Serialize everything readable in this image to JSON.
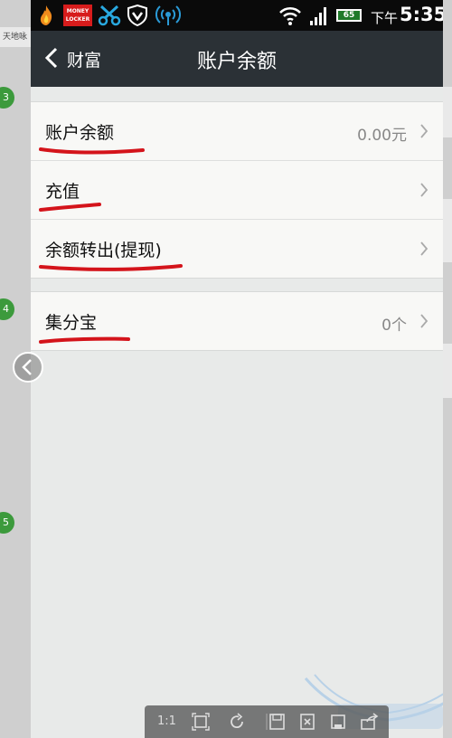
{
  "background_page": {
    "top_text": "天地咏",
    "step_numbers": [
      "3",
      "4",
      "5"
    ]
  },
  "statusbar": {
    "app_badge": "MONEY LOCKER",
    "battery_level": "65",
    "ampm": "下午",
    "time": "5:35"
  },
  "navbar": {
    "back_label": "财富",
    "title": "账户余额"
  },
  "rows": [
    {
      "label": "账户余额",
      "value": "0.00元"
    },
    {
      "label": "充值",
      "value": ""
    },
    {
      "label": "余额转出(提现)",
      "value": ""
    },
    {
      "label": "集分宝",
      "value": "0个"
    }
  ],
  "viewer_toolbar": {
    "ratio_label": "1:1"
  },
  "colors": {
    "navbar_bg": "#2b3136",
    "row_bg": "#f8f8f6",
    "page_bg": "#e8eae9",
    "annotation_red": "#d4141b"
  }
}
